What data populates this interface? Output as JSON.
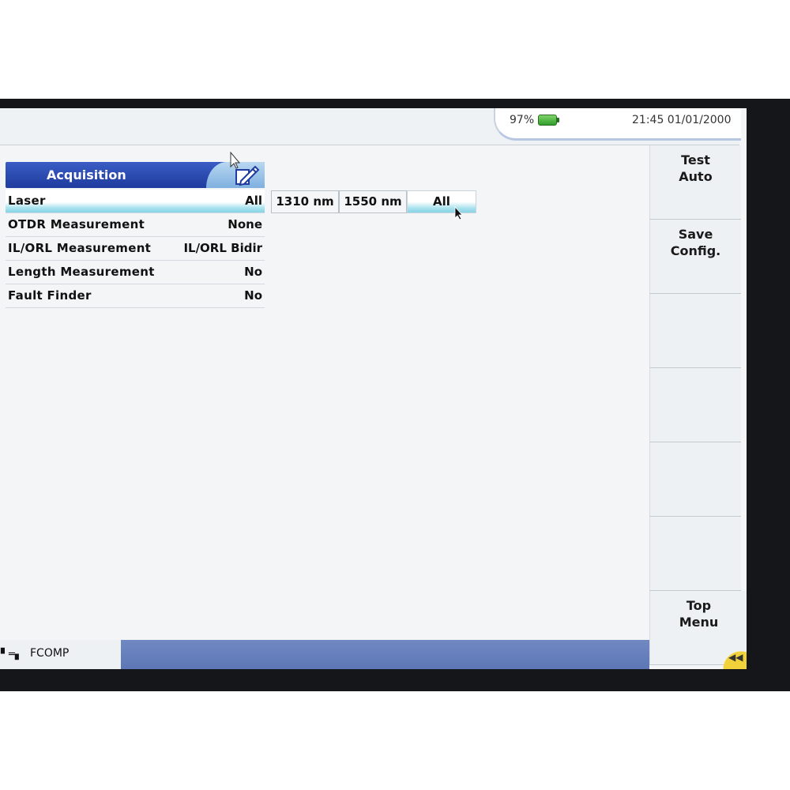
{
  "status": {
    "battery": "97%",
    "datetime": "21:45  01/01/2000"
  },
  "acquisition": {
    "title": "Acquisition",
    "rows": [
      {
        "label": "Laser",
        "value": "All"
      },
      {
        "label": "OTDR Measurement",
        "value": "None"
      },
      {
        "label": "IL/ORL Measurement",
        "value": "IL/ORL Bidir"
      },
      {
        "label": "Length Measurement",
        "value": "No"
      },
      {
        "label": "Fault Finder",
        "value": "No"
      }
    ],
    "laser_options": [
      "1310 nm",
      "1550 nm",
      "All"
    ],
    "selected_option": "All"
  },
  "softkeys": {
    "test_auto": [
      "Test",
      "Auto"
    ],
    "save_config": [
      "Save",
      "Config."
    ],
    "top_menu": [
      "Top",
      "Menu"
    ]
  },
  "bottom": {
    "fcomp_icon": "▘═▖",
    "fcomp": "FCOMP",
    "back_glyph": "◀◀"
  },
  "icons": {
    "edit": "edit-pencil-icon",
    "battery": "battery-icon",
    "back": "rewind-icon"
  }
}
